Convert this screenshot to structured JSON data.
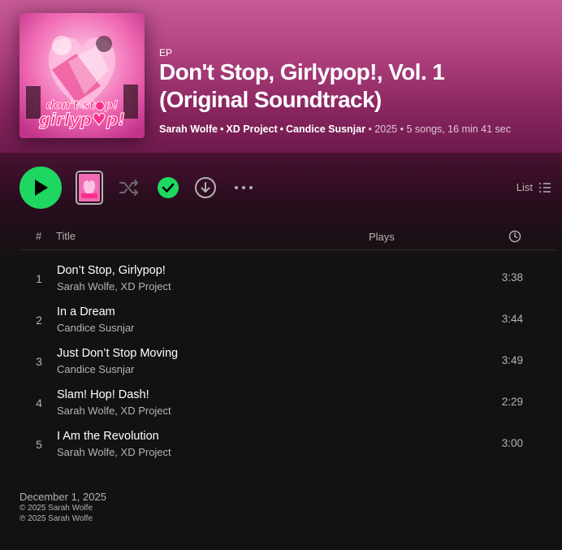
{
  "album": {
    "type": "EP",
    "title": "Don't Stop, Girlypop!, Vol. 1 (Original Soundtrack)",
    "artists": [
      "Sarah Wolfe",
      "XD Project",
      "Candice Susnjar"
    ],
    "year": "2025",
    "summary": "5 songs, 16 min 41 sec",
    "cover_text": "don't stop girlypop!"
  },
  "controls": {
    "view_label": "List"
  },
  "table": {
    "col_num": "#",
    "col_title": "Title",
    "col_plays": "Plays"
  },
  "tracks": [
    {
      "num": "1",
      "title": "Don’t Stop, Girlypop!",
      "artists": "Sarah Wolfe, XD Project",
      "duration": "3:38"
    },
    {
      "num": "2",
      "title": "In a Dream",
      "artists": "Candice Susnjar",
      "duration": "3:44"
    },
    {
      "num": "3",
      "title": "Just Don’t Stop Moving",
      "artists": "Candice Susnjar",
      "duration": "3:49"
    },
    {
      "num": "4",
      "title": "Slam! Hop! Dash!",
      "artists": "Sarah Wolfe, XD Project",
      "duration": "2:29"
    },
    {
      "num": "5",
      "title": "I Am the Revolution",
      "artists": "Sarah Wolfe, XD Project",
      "duration": "3:00"
    }
  ],
  "footer": {
    "release_date": "December 1, 2025",
    "copyright": "© 2025 Sarah Wolfe",
    "phonographic": "℗ 2025 Sarah Wolfe"
  },
  "colors": {
    "accent": "#1ed760",
    "header_top": "#c75a98",
    "header_bottom": "#6e1a4c",
    "background": "#121212"
  },
  "icons": [
    "play-icon",
    "shuffle-icon",
    "check-circle-icon",
    "download-icon",
    "more-icon",
    "list-icon",
    "clock-icon"
  ]
}
